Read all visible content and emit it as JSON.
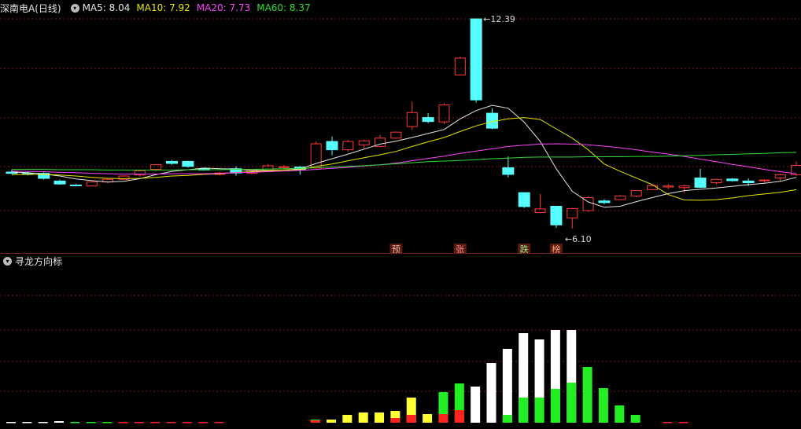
{
  "main_panel": {
    "title": "深南电A(日线)",
    "ma": [
      {
        "label": "MA5:",
        "value": "8.04",
        "color": "#e6e6e6"
      },
      {
        "label": "MA10:",
        "value": "7.92",
        "color": "#e8e800"
      },
      {
        "label": "MA20:",
        "value": "7.73",
        "color": "#ff44ff"
      },
      {
        "label": "MA60:",
        "value": "8.37",
        "color": "#33dd33"
      }
    ],
    "high_label": "12.39",
    "low_label": "6.10",
    "markers": [
      "预",
      "张",
      "跌",
      "榜"
    ]
  },
  "sub_panel": {
    "title": "寻龙方向标"
  },
  "colors": {
    "up": "#ff3a3a",
    "down": "#55ffff",
    "grid": "#7a1d1d"
  },
  "chart_data": {
    "type": "candlestick",
    "series": [
      {
        "name": "MA5",
        "ref": "ma5"
      },
      {
        "name": "MA10",
        "ref": "ma10"
      },
      {
        "name": "MA20",
        "ref": "ma20"
      },
      {
        "name": "MA60",
        "ref": "ma60"
      }
    ],
    "ohlc": [
      [
        7.78,
        7.85,
        7.72,
        7.74
      ],
      [
        7.74,
        7.78,
        7.68,
        7.71
      ],
      [
        7.74,
        7.78,
        7.55,
        7.59
      ],
      [
        7.51,
        7.55,
        7.4,
        7.42
      ],
      [
        7.39,
        7.42,
        7.35,
        7.37
      ],
      [
        7.36,
        7.5,
        7.35,
        7.48
      ],
      [
        7.48,
        7.58,
        7.45,
        7.56
      ],
      [
        7.56,
        7.68,
        7.54,
        7.66
      ],
      [
        7.69,
        7.84,
        7.64,
        7.82
      ],
      [
        7.86,
        8.02,
        7.8,
        8.0
      ],
      [
        8.1,
        8.14,
        8.0,
        8.04
      ],
      [
        8.1,
        8.12,
        7.91,
        7.95
      ],
      [
        7.88,
        7.91,
        7.82,
        7.84
      ],
      [
        7.71,
        7.78,
        7.68,
        7.75
      ],
      [
        7.88,
        7.95,
        7.67,
        7.75
      ],
      [
        7.74,
        7.86,
        7.72,
        7.84
      ],
      [
        7.8,
        8.02,
        7.78,
        7.97
      ],
      [
        7.92,
        7.99,
        7.88,
        7.94
      ],
      [
        7.93,
        7.96,
        7.7,
        7.84
      ],
      [
        7.9,
        8.7,
        7.88,
        8.63
      ],
      [
        8.7,
        8.85,
        8.28,
        8.45
      ],
      [
        8.45,
        8.75,
        8.39,
        8.7
      ],
      [
        8.6,
        8.75,
        8.49,
        8.72
      ],
      [
        8.55,
        8.9,
        8.53,
        8.8
      ],
      [
        8.8,
        9.0,
        8.78,
        8.98
      ],
      [
        9.15,
        9.9,
        9.05,
        9.57
      ],
      [
        9.42,
        9.55,
        9.25,
        9.3
      ],
      [
        9.29,
        9.85,
        9.22,
        9.8
      ],
      [
        10.7,
        11.25,
        10.7,
        11.21
      ],
      [
        12.39,
        12.39,
        9.87,
        9.95
      ],
      [
        9.55,
        9.7,
        9.07,
        9.1
      ],
      [
        7.91,
        8.25,
        7.62,
        7.71
      ],
      [
        7.16,
        7.16,
        6.7,
        6.74
      ],
      [
        6.56,
        7.12,
        6.54,
        6.67
      ],
      [
        6.75,
        6.75,
        6.1,
        6.19
      ],
      [
        6.4,
        6.7,
        6.08,
        6.68
      ],
      [
        6.62,
        7.05,
        6.58,
        7.01
      ],
      [
        6.91,
        6.96,
        6.81,
        6.86
      ],
      [
        6.95,
        7.1,
        6.94,
        7.06
      ],
      [
        7.06,
        7.23,
        7.02,
        7.22
      ],
      [
        7.25,
        7.4,
        7.24,
        7.37
      ],
      [
        7.33,
        7.42,
        7.26,
        7.36
      ],
      [
        7.31,
        7.4,
        7.16,
        7.36
      ],
      [
        7.6,
        7.88,
        7.3,
        7.32
      ],
      [
        7.46,
        7.58,
        7.4,
        7.56
      ],
      [
        7.57,
        7.6,
        7.49,
        7.52
      ],
      [
        7.51,
        7.59,
        7.36,
        7.46
      ],
      [
        7.52,
        7.56,
        7.44,
        7.54
      ],
      [
        7.6,
        7.73,
        7.49,
        7.7
      ],
      [
        7.7,
        8.1,
        7.66,
        7.98
      ]
    ],
    "ma5": [
      7.78,
      7.76,
      7.72,
      7.66,
      7.57,
      7.52,
      7.48,
      7.5,
      7.58,
      7.7,
      7.8,
      7.85,
      7.9,
      7.88,
      7.87,
      7.82,
      7.83,
      7.84,
      7.87,
      8.04,
      8.18,
      8.32,
      8.47,
      8.62,
      8.71,
      8.82,
      8.94,
      9.06,
      9.38,
      9.63,
      9.79,
      9.7,
      9.28,
      8.7,
      7.88,
      7.2,
      6.88,
      6.72,
      6.75,
      6.89,
      7.01,
      7.13,
      7.22,
      7.26,
      7.3,
      7.35,
      7.4,
      7.44,
      7.5,
      7.62
    ],
    "ma10": [
      7.7,
      7.71,
      7.71,
      7.69,
      7.66,
      7.62,
      7.59,
      7.58,
      7.59,
      7.62,
      7.66,
      7.68,
      7.71,
      7.73,
      7.77,
      7.79,
      7.82,
      7.84,
      7.85,
      7.95,
      8.02,
      8.12,
      8.21,
      8.3,
      8.4,
      8.55,
      8.69,
      8.82,
      9.0,
      9.17,
      9.3,
      9.38,
      9.42,
      9.36,
      9.08,
      8.8,
      8.45,
      8.02,
      7.8,
      7.6,
      7.4,
      7.1,
      6.94,
      6.93,
      6.95,
      7.0,
      7.07,
      7.12,
      7.17,
      7.25
    ],
    "ma20": [
      7.81,
      7.8,
      7.79,
      7.77,
      7.76,
      7.74,
      7.73,
      7.72,
      7.72,
      7.72,
      7.73,
      7.73,
      7.73,
      7.74,
      7.76,
      7.77,
      7.79,
      7.81,
      7.83,
      7.86,
      7.89,
      7.92,
      7.96,
      8.0,
      8.05,
      8.12,
      8.19,
      8.26,
      8.34,
      8.41,
      8.48,
      8.55,
      8.59,
      8.62,
      8.63,
      8.62,
      8.6,
      8.56,
      8.51,
      8.45,
      8.38,
      8.32,
      8.25,
      8.17,
      8.09,
      8.01,
      7.94,
      7.86,
      7.79,
      7.73
    ],
    "ma60": [
      7.86,
      7.86,
      7.86,
      7.85,
      7.85,
      7.85,
      7.84,
      7.84,
      7.84,
      7.84,
      7.84,
      7.85,
      7.85,
      7.85,
      7.86,
      7.86,
      7.87,
      7.88,
      7.89,
      7.91,
      7.93,
      7.95,
      7.97,
      8.0,
      8.03,
      8.06,
      8.09,
      8.11,
      8.13,
      8.15,
      8.18,
      8.2,
      8.22,
      8.23,
      8.23,
      8.23,
      8.24,
      8.24,
      8.24,
      8.25,
      8.25,
      8.26,
      8.27,
      8.28,
      8.3,
      8.31,
      8.33,
      8.34,
      8.36,
      8.37
    ],
    "marker_days": [
      24,
      28,
      32,
      34
    ],
    "high_day": 29,
    "low_day": 34,
    "indicator": {
      "bars": [
        {
          "d": 0,
          "v": 1,
          "c": "white"
        },
        {
          "d": 1,
          "v": 1,
          "c": "white"
        },
        {
          "d": 2,
          "v": 1,
          "c": "white"
        },
        {
          "d": 3,
          "v": 2,
          "c": "white"
        },
        {
          "d": 4,
          "v": 1,
          "c": "green"
        },
        {
          "d": 5,
          "v": 1,
          "c": "green"
        },
        {
          "d": 6,
          "v": 1,
          "c": "green"
        },
        {
          "d": 7,
          "v": 1,
          "c": "red"
        },
        {
          "d": 8,
          "v": 1,
          "c": "red"
        },
        {
          "d": 9,
          "v": 1,
          "c": "red"
        },
        {
          "d": 10,
          "v": 1,
          "c": "red"
        },
        {
          "d": 11,
          "v": 1,
          "c": "red"
        },
        {
          "d": 12,
          "v": 1,
          "c": "red"
        },
        {
          "d": 13,
          "v": 1,
          "c": "red"
        },
        {
          "d": 19,
          "v": 4,
          "c": "green"
        },
        {
          "d": 20,
          "v": 4,
          "c": "yellow"
        },
        {
          "d": 21,
          "v": 10,
          "c": "yellow"
        },
        {
          "d": 22,
          "v": 13,
          "c": "yellow"
        },
        {
          "d": 23,
          "v": 13,
          "c": "yellow"
        },
        {
          "d": 24,
          "v": 15,
          "c": "yellow"
        },
        {
          "d": 25,
          "v": 32,
          "c": "yellow"
        },
        {
          "d": 26,
          "v": 11,
          "c": "yellow"
        },
        {
          "d": 27,
          "v": 39,
          "c": "green"
        },
        {
          "d": 28,
          "v": 50,
          "c": "green"
        },
        {
          "d": 29,
          "v": 46,
          "c": "white"
        },
        {
          "d": 30,
          "v": 76,
          "c": "white"
        },
        {
          "d": 31,
          "v": 94,
          "c": "white"
        },
        {
          "d": 32,
          "v": 114,
          "c": "white"
        },
        {
          "d": 33,
          "v": 106,
          "c": "white"
        },
        {
          "d": 34,
          "v": 118,
          "c": "white"
        },
        {
          "d": 35,
          "v": 118,
          "c": "white"
        },
        {
          "d": 36,
          "v": 71,
          "c": "green"
        },
        {
          "d": 37,
          "v": 44,
          "c": "green"
        },
        {
          "d": 38,
          "v": 22,
          "c": "green"
        },
        {
          "d": 39,
          "v": 10,
          "c": "green"
        },
        {
          "d": 41,
          "v": 1,
          "c": "red"
        },
        {
          "d": 42,
          "v": 1,
          "c": "red"
        }
      ],
      "overlays": [
        {
          "d": 19,
          "v": 3,
          "c": "red"
        },
        {
          "d": 24,
          "v": 6,
          "c": "red"
        },
        {
          "d": 25,
          "v": 10,
          "c": "red"
        },
        {
          "d": 27,
          "v": 11,
          "c": "red"
        },
        {
          "d": 28,
          "v": 16,
          "c": "red"
        },
        {
          "d": 31,
          "v": 10,
          "c": "green"
        },
        {
          "d": 32,
          "v": 32,
          "c": "green"
        },
        {
          "d": 33,
          "v": 32,
          "c": "green"
        },
        {
          "d": 34,
          "v": 43,
          "c": "green"
        },
        {
          "d": 35,
          "v": 51,
          "c": "green"
        }
      ]
    }
  }
}
